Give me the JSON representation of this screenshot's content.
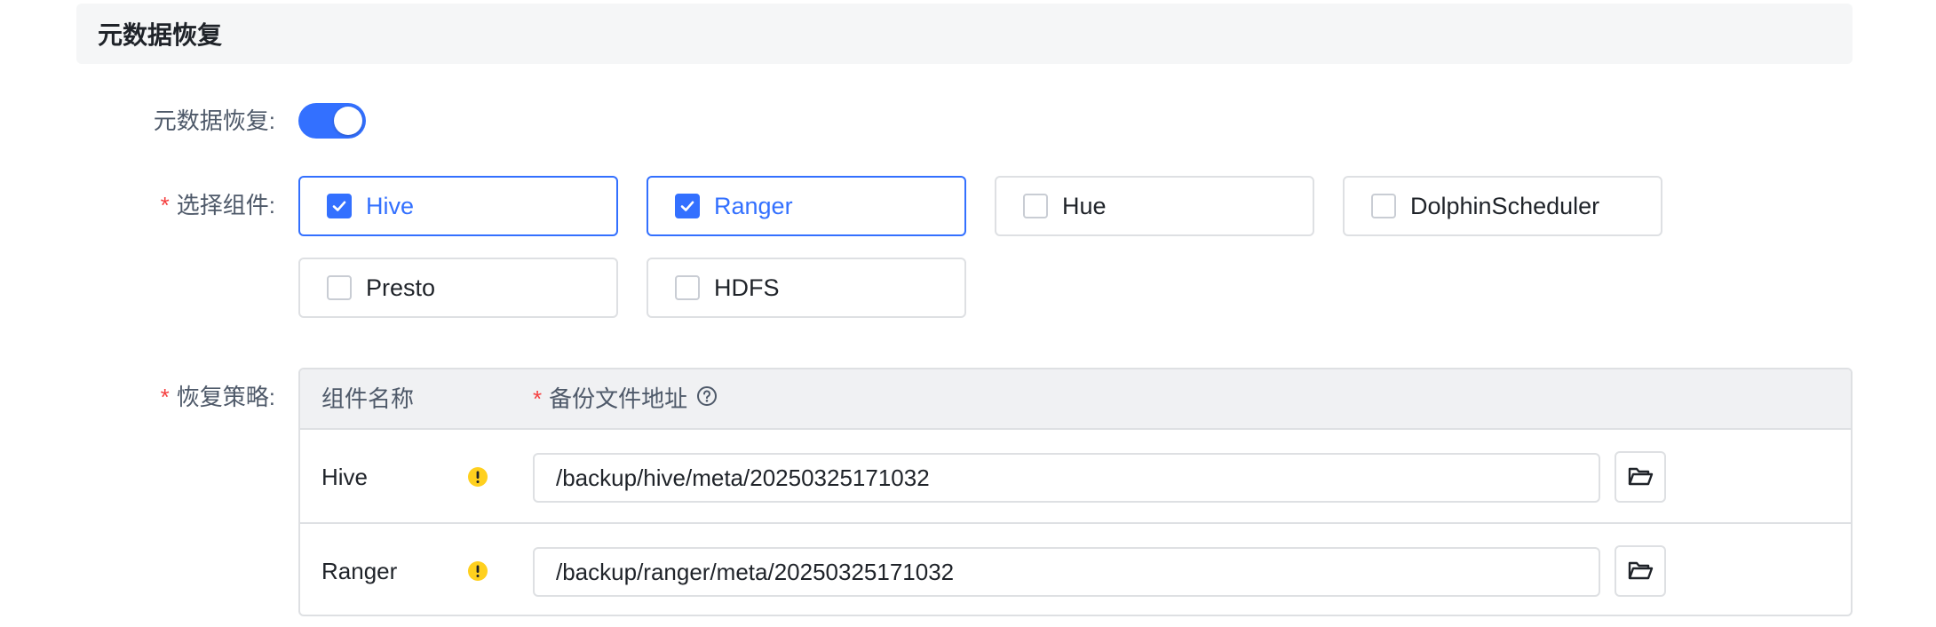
{
  "section": {
    "title": "元数据恢复"
  },
  "form": {
    "restore_label": "元数据恢复:",
    "restore_enabled": true,
    "components_label": "选择组件:",
    "required_mark": "*",
    "components": [
      {
        "label": "Hive",
        "checked": true
      },
      {
        "label": "Ranger",
        "checked": true
      },
      {
        "label": "Hue",
        "checked": false
      },
      {
        "label": "DolphinScheduler",
        "checked": false
      },
      {
        "label": "Presto",
        "checked": false
      },
      {
        "label": "HDFS",
        "checked": false
      }
    ],
    "strategy_label": "恢复策略:"
  },
  "table": {
    "col_name": "组件名称",
    "col_path": "备份文件地址",
    "rows": [
      {
        "name": "Hive",
        "path": "/backup/hive/meta/20250325171032"
      },
      {
        "name": "Ranger",
        "path": "/backup/ranger/meta/20250325171032"
      }
    ]
  },
  "icons": {
    "help": "question-circle-icon",
    "warning": "exclamation-circle-icon",
    "folder": "folder-open-icon",
    "check": "check-icon"
  },
  "colors": {
    "primary": "#3370ff",
    "required": "#f53f3f",
    "warning": "#ffd01e",
    "border": "#dee0e3"
  }
}
